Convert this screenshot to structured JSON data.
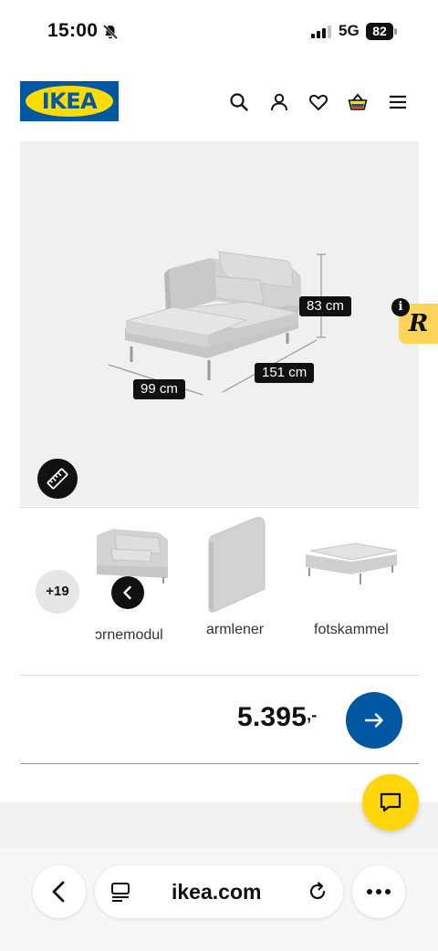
{
  "status_bar": {
    "time": "15:00",
    "network": "5G",
    "battery": "82"
  },
  "header": {
    "logo_text": "IKEA",
    "icons": [
      "search-icon",
      "user-icon",
      "heart-icon",
      "basket-icon",
      "menu-icon"
    ]
  },
  "product_image": {
    "dimensions": {
      "height": "83 cm",
      "depth": "151 cm",
      "width": "99 cm"
    }
  },
  "variants": {
    "more_count": "+19",
    "items": [
      {
        "label": "ɔrnemodul"
      },
      {
        "label": "armlener"
      },
      {
        "label": "fotskammel"
      }
    ]
  },
  "price": {
    "value": "5.395",
    "suffix": ",-"
  },
  "browser": {
    "url": "ikea.com"
  },
  "colors": {
    "ikea_blue": "#0058a3",
    "ikea_yellow": "#ffdb00",
    "chat_yellow": "#ffd60a"
  }
}
